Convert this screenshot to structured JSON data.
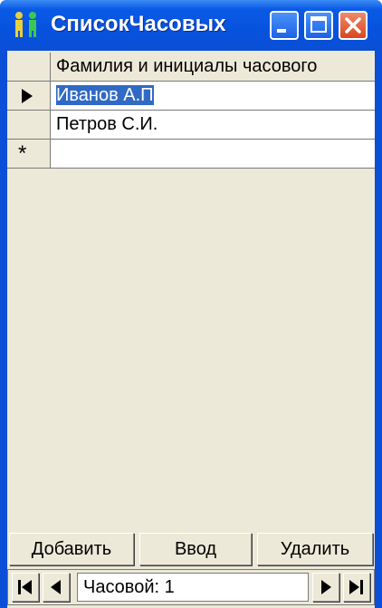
{
  "window": {
    "title": "СписокЧасовых",
    "icon": "people-icon"
  },
  "grid": {
    "column_header": "Фамилия и инициалы часового",
    "rows": [
      {
        "value": "Иванов А.П",
        "selected": true
      },
      {
        "value": "Петров С.И."
      }
    ],
    "new_row_marker": "*"
  },
  "buttons": {
    "add": "Добавить",
    "enter": "Ввод",
    "delete": "Удалить"
  },
  "navigator": {
    "status": "Часовой: 1"
  },
  "colors": {
    "titlebar": "#0a4fd6",
    "selection": "#316ac5",
    "face": "#ece9d8"
  }
}
